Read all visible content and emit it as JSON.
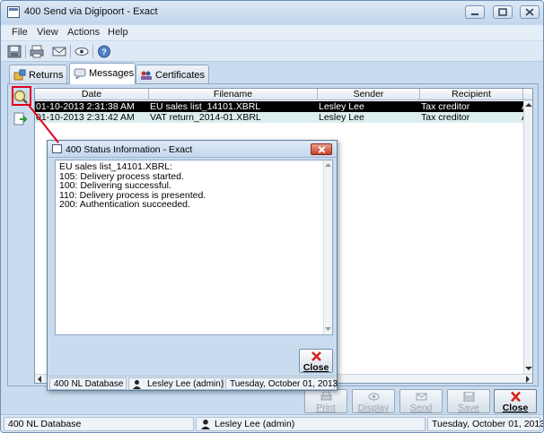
{
  "window": {
    "title": "400 Send via Digipoort - Exact",
    "icons": {
      "minimize": "minimize-icon",
      "maximize": "maximize-icon",
      "close": "close-icon"
    }
  },
  "menu": {
    "items": [
      "File",
      "View",
      "Actions",
      "Help"
    ]
  },
  "toolbar": {
    "icons": [
      "save-icon",
      "print-icon",
      "email-icon",
      "preview-icon",
      "help-icon"
    ]
  },
  "tabs": [
    {
      "label": "Returns",
      "icon": "returns-icon",
      "active": false
    },
    {
      "label": "Messages",
      "icon": "messages-icon",
      "active": true
    },
    {
      "label": "Certificates",
      "icon": "certificates-icon",
      "active": false
    }
  ],
  "side_buttons": [
    "magnify-icon",
    "export-icon"
  ],
  "grid": {
    "columns": [
      "Date",
      "Filename",
      "Sender",
      "Recipient"
    ],
    "rows": [
      {
        "date": "01-10-2013 2:31:38 AM",
        "filename": "EU sales list_14101.XBRL",
        "sender": "Lesley Lee",
        "recipient": "Tax creditor",
        "extra": "Ap",
        "selected": true
      },
      {
        "date": "01-10-2013 2:31:42 AM",
        "filename": "VAT return_2014-01.XBRL",
        "sender": "Lesley Lee",
        "recipient": "Tax creditor",
        "extra": "Ap",
        "selected": false
      }
    ]
  },
  "dialog": {
    "title": "400 Status Information - Exact",
    "lines": [
      "EU sales list_14101.XBRL:",
      "105: Delivery process started.",
      "100: Delivering successful.",
      "110: Delivery process is presented.",
      "200: Authentication succeeded."
    ],
    "close_label": "Close",
    "status": {
      "database": "400 NL Database",
      "user": "Lesley Lee (admin)",
      "date": "Tuesday, October 01, 2013"
    }
  },
  "buttons": [
    {
      "label": "Print",
      "enabled": false,
      "icon": "printer-icon"
    },
    {
      "label": "Display",
      "enabled": false,
      "icon": "eye-icon"
    },
    {
      "label": "Send",
      "enabled": false,
      "icon": "send-icon"
    },
    {
      "label": "Save",
      "enabled": false,
      "icon": "save-icon"
    },
    {
      "label": "Close",
      "enabled": true,
      "icon": "close-x-icon"
    }
  ],
  "statusbar": {
    "database": "400 NL Database",
    "user": "Lesley Lee (admin)",
    "date": "Tuesday, October 01, 2013"
  },
  "colors": {
    "accent_highlight": "#e0001b",
    "selected_row": "#000000",
    "alt_row": "#dcefee",
    "window_bg": "#c9dcef"
  }
}
